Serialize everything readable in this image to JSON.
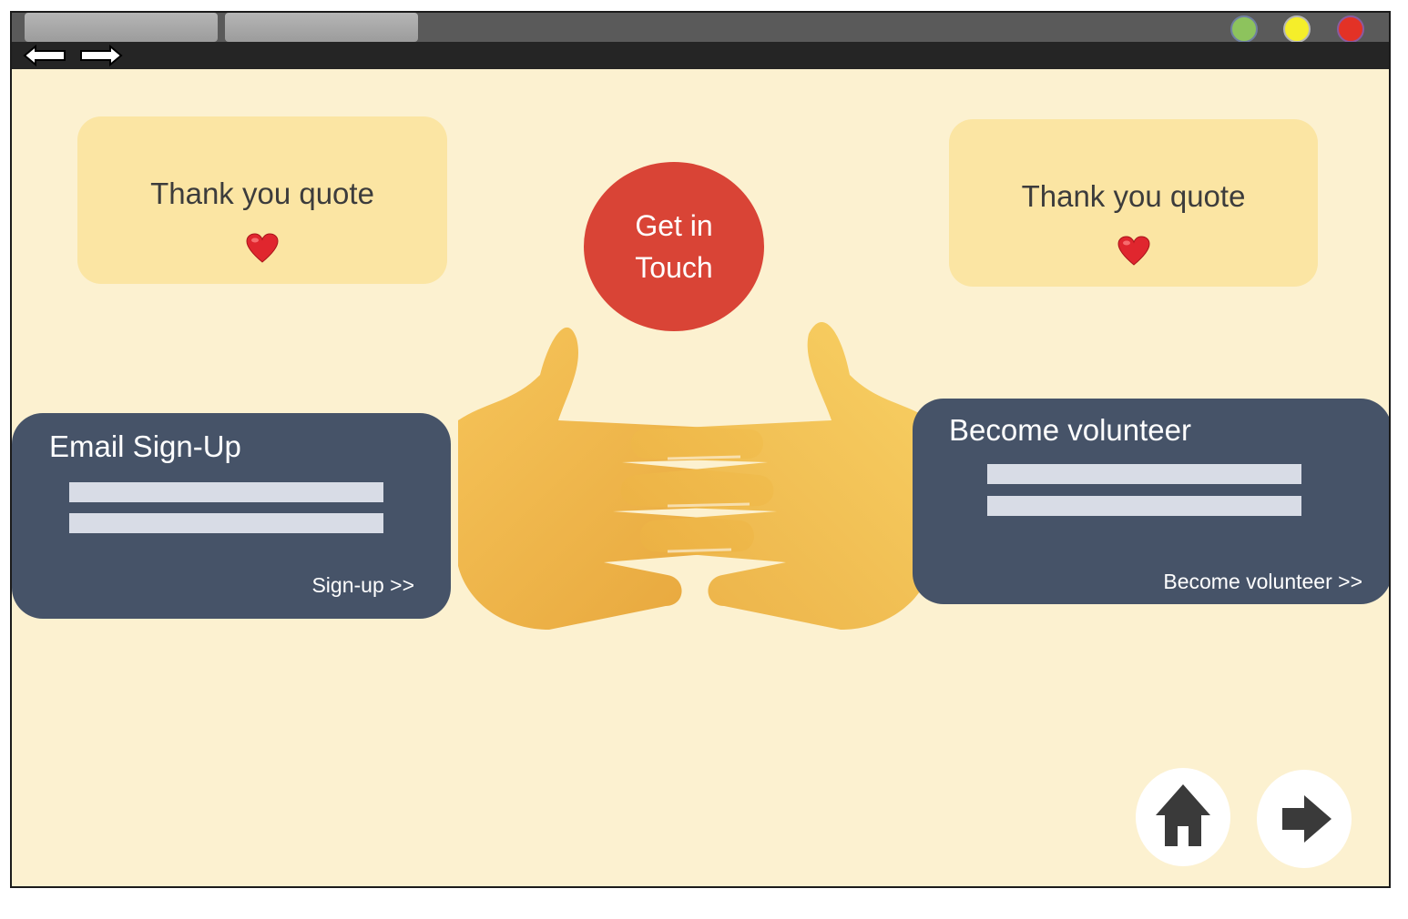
{
  "window": {
    "tabs": [
      "",
      ""
    ],
    "traffic_lights": [
      {
        "name": "green",
        "color": "#8dc35d"
      },
      {
        "name": "yellow",
        "color": "#f5ee2a"
      },
      {
        "name": "red",
        "color": "#e33226"
      }
    ],
    "nav_icons": [
      "back-arrow-icon",
      "forward-arrow-icon"
    ]
  },
  "colors": {
    "background": "#fcf1d0",
    "quote_card": "#fbe5a3",
    "cta": "#d94436",
    "panel": "#465368",
    "field": "#d8dce6"
  },
  "quotes": {
    "left": {
      "text": "Thank you quote",
      "icon": "heart-icon"
    },
    "right": {
      "text": "Thank you quote",
      "icon": "heart-icon"
    }
  },
  "cta": {
    "label": "Get in Touch"
  },
  "illustration": {
    "icon": "handshake-hands-icon"
  },
  "email_signup": {
    "title": "Email Sign-Up",
    "fields": [
      "",
      ""
    ],
    "link": "Sign-up >>"
  },
  "volunteer": {
    "title": "Become volunteer",
    "fields": [
      "",
      ""
    ],
    "link": "Become volunteer >>"
  },
  "footer_nav": {
    "home_icon": "home-icon",
    "next_icon": "right-arrow-icon"
  }
}
